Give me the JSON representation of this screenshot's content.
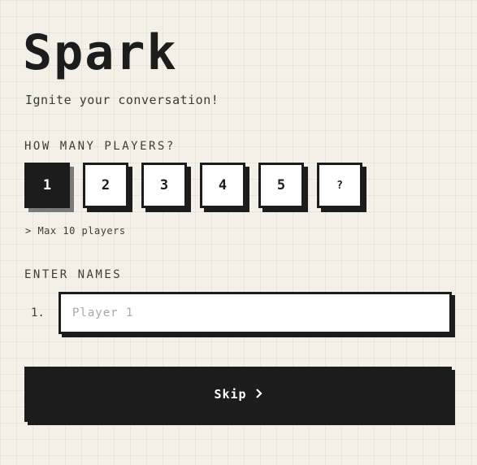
{
  "app": {
    "title": "Spark",
    "subtitle": "Ignite your conversation!"
  },
  "players": {
    "label": "HOW MANY PLAYERS?",
    "options": [
      "1",
      "2",
      "3",
      "4",
      "5",
      "?"
    ],
    "selected": "1",
    "hint": "> Max 10 players"
  },
  "names": {
    "label": "ENTER NAMES",
    "rows": [
      {
        "number": "1.",
        "placeholder": "Player 1",
        "value": ""
      }
    ]
  },
  "action": {
    "skip_label": "Skip",
    "skip_icon": "chevron-right-icon"
  },
  "colors": {
    "background": "#f4efe7",
    "ink": "#1c1c1c",
    "selected_shadow": "#7a7a7a",
    "card": "#ffffff"
  }
}
